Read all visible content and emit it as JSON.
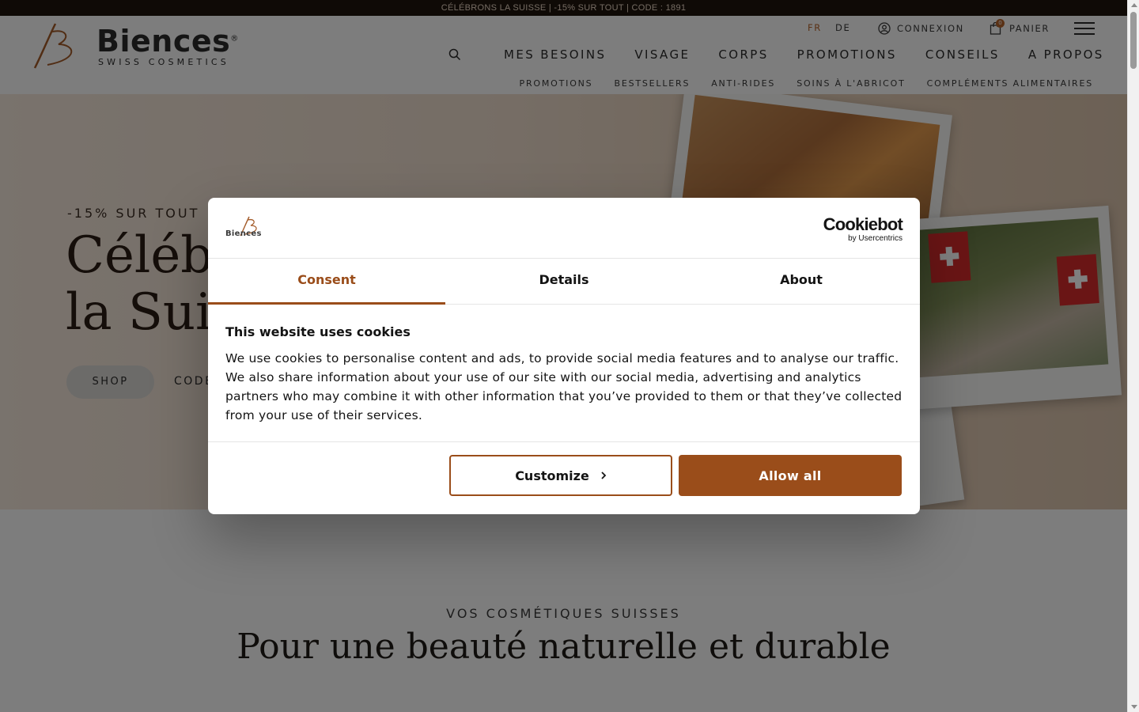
{
  "promo_bar": {
    "text": "CÉLÉBRONS LA SUISSE | -15% SUR TOUT | CODE : 1891"
  },
  "logo": {
    "name": "Biences",
    "registered": "®",
    "tagline": "SWISS COSMETICS"
  },
  "utility": {
    "lang_fr": "FR",
    "lang_de": "DE",
    "login": "CONNEXION",
    "cart": "PANIER",
    "cart_count": "0",
    "accent_color": "#b4622a"
  },
  "main_nav": [
    "MES BESOINS",
    "VISAGE",
    "CORPS",
    "PROMOTIONS",
    "CONSEILS",
    "A PROPOS"
  ],
  "sub_nav": [
    "PROMOTIONS",
    "BESTSELLERS",
    "ANTI-RIDES",
    "SOINS À L'ABRICOT",
    "COMPLÉMENTS ALIMENTAIRES"
  ],
  "hero": {
    "tag": "-15% SUR TOUT",
    "title_line1": "Célébrons",
    "title_line2": "la Suisse",
    "shop_button": "SHOP",
    "code_text": "CODE : 1891"
  },
  "section": {
    "tag": "VOS COSMÉTIQUES SUISSES",
    "title": "Pour une beauté naturelle et durable"
  },
  "cookie_dialog": {
    "logo_text": "Biences",
    "provider_name": "Cookiebot",
    "provider_sub": "by Usercentrics",
    "tabs": [
      "Consent",
      "Details",
      "About"
    ],
    "active_tab": "Consent",
    "heading": "This website uses cookies",
    "body": "We use cookies to personalise content and ads, to provide social media features and to analyse our traffic. We also share information about your use of our site with our social media, advertising and analytics partners who may combine it with other information that you’ve provided to them or that they’ve collected from your use of their services.",
    "customize_button": "Customize",
    "allow_button": "Allow all",
    "brand_color": "#9a4d1a"
  }
}
